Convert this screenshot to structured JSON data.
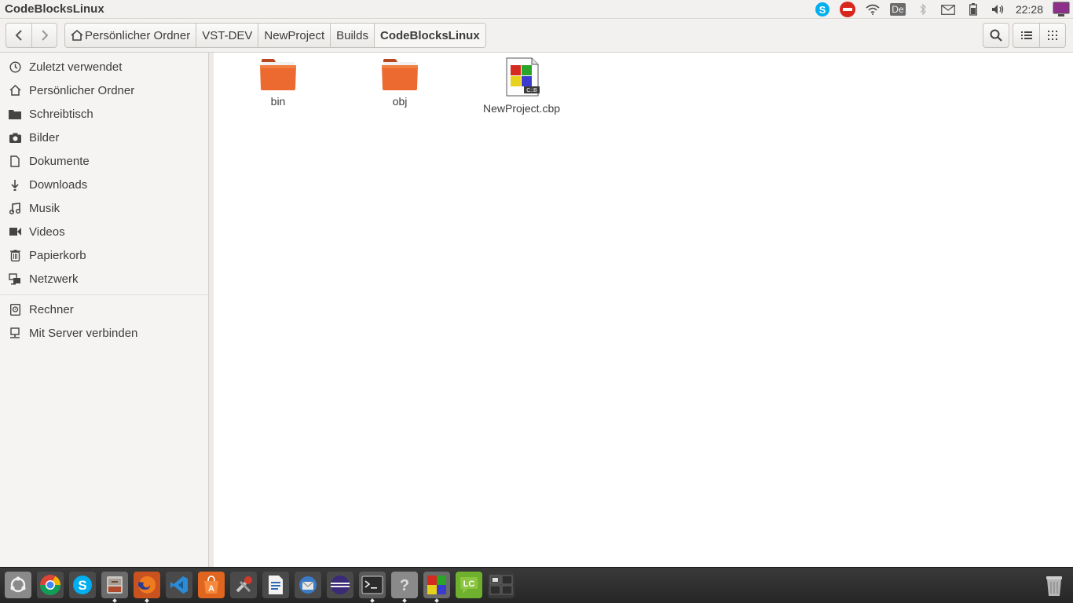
{
  "window": {
    "title": "CodeBlocksLinux"
  },
  "tray": {
    "keyboard_layout": "De",
    "clock": "22:28"
  },
  "breadcrumb": [
    {
      "label": "Persönlicher Ordner"
    },
    {
      "label": "VST-DEV"
    },
    {
      "label": "NewProject"
    },
    {
      "label": "Builds"
    },
    {
      "label": "CodeBlocksLinux"
    }
  ],
  "sidebar": {
    "places": [
      {
        "label": "Zuletzt verwendet",
        "icon": "clock-icon"
      },
      {
        "label": "Persönlicher Ordner",
        "icon": "home-icon"
      },
      {
        "label": "Schreibtisch",
        "icon": "desktop-folder-icon"
      },
      {
        "label": "Bilder",
        "icon": "camera-icon"
      },
      {
        "label": "Dokumente",
        "icon": "document-icon"
      },
      {
        "label": "Downloads",
        "icon": "download-icon"
      },
      {
        "label": "Musik",
        "icon": "music-icon"
      },
      {
        "label": "Videos",
        "icon": "video-icon"
      },
      {
        "label": "Papierkorb",
        "icon": "trash-icon"
      },
      {
        "label": "Netzwerk",
        "icon": "network-icon"
      }
    ],
    "devices": [
      {
        "label": "Rechner",
        "icon": "computer-icon"
      },
      {
        "label": "Mit Server verbinden",
        "icon": "server-icon"
      }
    ]
  },
  "files": [
    {
      "name": "bin",
      "type": "folder"
    },
    {
      "name": "obj",
      "type": "folder"
    },
    {
      "name": "NewProject.cbp",
      "type": "codeblocks-project"
    }
  ],
  "colors": {
    "folder_orange": "#e9632f",
    "dock_bg": "#2d2d2d",
    "skype_blue": "#00aff0"
  }
}
